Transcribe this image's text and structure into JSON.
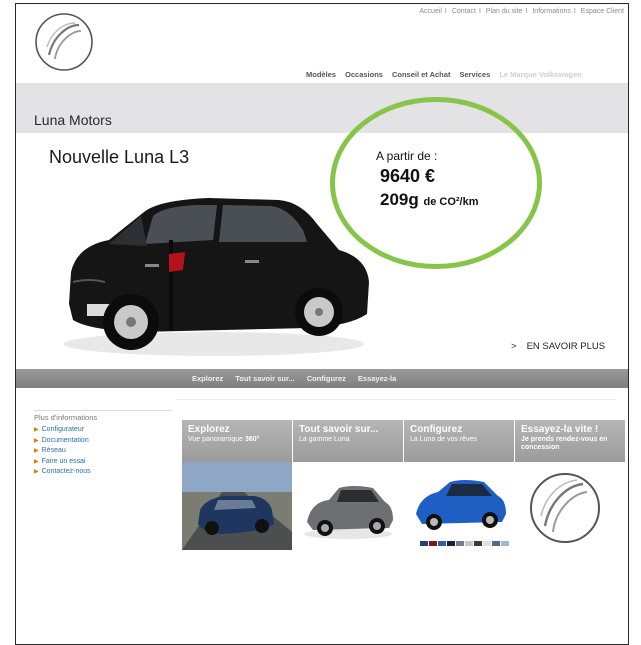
{
  "top_links": [
    "Accueil",
    "Contact",
    "Plan du site",
    "Informations",
    "Espace Client"
  ],
  "main_nav": [
    "Modèles",
    "Occasions",
    "Conseil et Achat",
    "Services"
  ],
  "main_nav_faded": "Le Marque Volkswagen",
  "brand": "Luna Motors",
  "hero": {
    "title": "Nouvelle Luna L3",
    "price_label": "A partir de :",
    "price": "9640 €",
    "co2_value": "209g",
    "co2_unit": "de CO²/km",
    "more_arrow": ">",
    "more_label": "EN SAVOIR PLUS"
  },
  "sub_nav": [
    "Explorez",
    "Tout savoir sur...",
    "Configurez",
    "Essayez-la"
  ],
  "sidebar": {
    "title": "Plus d'informations",
    "items": [
      "Configurateur",
      "Documentation",
      "Réseau",
      "Faire un essai",
      "Contactez-nous"
    ]
  },
  "tiles": [
    {
      "title": "Explorez",
      "subtitle_pre": "Vue panoramique ",
      "subtitle_bold": "360°"
    },
    {
      "title": "Tout savoir sur...",
      "subtitle": "La gamme Luna"
    },
    {
      "title": "Configurez",
      "subtitle": "La Luna de vos rêves"
    },
    {
      "title": "Essayez-la vite !",
      "subtitle": "Je prends rendez-vous en concession"
    }
  ],
  "swatch_colors": [
    "#2b3f6b",
    "#7a1a1a",
    "#2f5fa8",
    "#1c2230",
    "#6f7f90",
    "#c8c8c8",
    "#3a3a3a",
    "#e0e0e0",
    "#4b6c8c",
    "#aab5bf"
  ],
  "colors": {
    "accent_circle": "#86c44a",
    "link": "#2f6fae",
    "bullet": "#e07a00"
  }
}
